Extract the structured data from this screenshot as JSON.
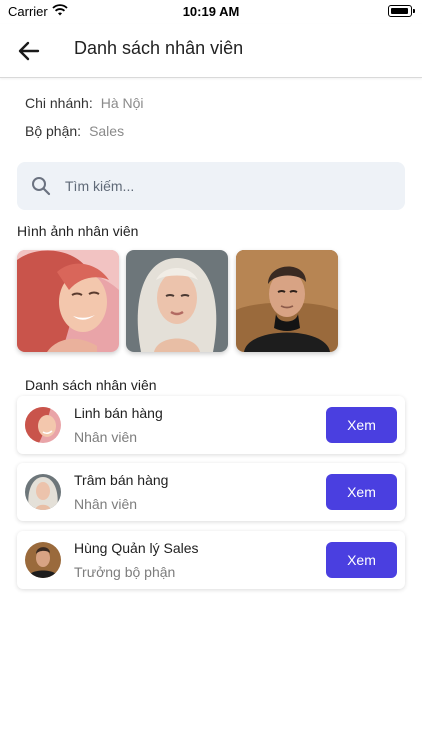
{
  "status_bar": {
    "carrier": "Carrier",
    "time": "10:19 AM"
  },
  "header": {
    "title": "Danh sách nhân viên"
  },
  "info": {
    "branch_label": "Chi nhánh:",
    "branch_value": "Hà Nội",
    "dept_label": "Bộ phận:",
    "dept_value": "Sales"
  },
  "search": {
    "placeholder": "Tìm kiếm..."
  },
  "photos": {
    "title": "Hình ảnh nhân viên"
  },
  "employees": {
    "title": "Danh sách nhân viên",
    "items": [
      {
        "name": "Linh bán hàng",
        "role": "Nhân viên",
        "action": "Xem"
      },
      {
        "name": "Trâm bán hàng",
        "role": "Nhân viên",
        "action": "Xem"
      },
      {
        "name": "Hùng Quản lý Sales",
        "role": "Trưởng bộ phận",
        "action": "Xem"
      }
    ]
  },
  "colors": {
    "accent": "#4a3fe0",
    "search_bg": "#eef2f7"
  }
}
